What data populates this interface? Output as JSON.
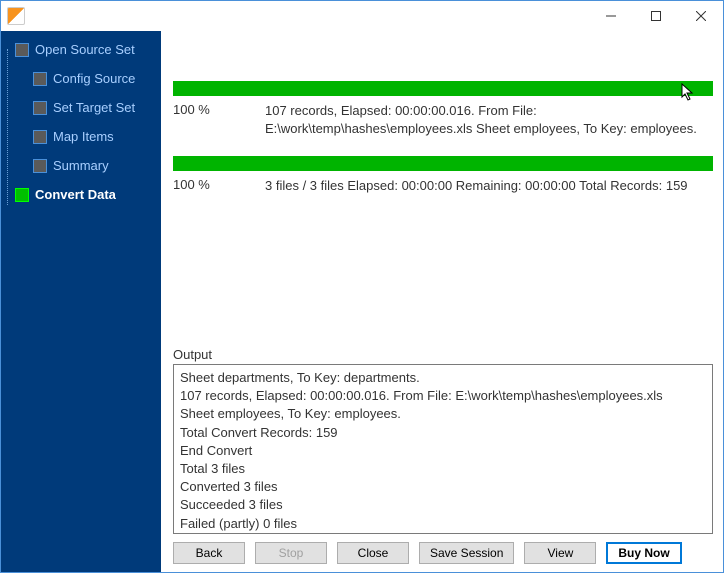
{
  "colors": {
    "sidebar_bg": "#003a7a",
    "accent": "#0078d7",
    "progress": "#00b400"
  },
  "titlebar": {
    "title": ""
  },
  "sidebar": {
    "root_label": "Open Source Set",
    "items": [
      {
        "label": "Config Source",
        "active": false
      },
      {
        "label": "Set Target Set",
        "active": false
      },
      {
        "label": "Map Items",
        "active": false
      },
      {
        "label": "Summary",
        "active": false
      },
      {
        "label": "Convert Data",
        "active": true
      }
    ]
  },
  "progress": {
    "task": {
      "percent_label": "100 %",
      "text": "107 records,    Elapsed: 00:00:00.016.    From File: E:\\work\\temp\\hashes\\employees.xls Sheet employees,    To Key: employees."
    },
    "overall": {
      "percent_label": "100 %",
      "text": "3 files / 3 files    Elapsed: 00:00:00    Remaining: 00:00:00    Total Records: 159"
    }
  },
  "output": {
    "label": "Output",
    "lines": [
      "Sheet departments,    To Key: departments.",
      "107 records,    Elapsed: 00:00:00.016.    From File: E:\\work\\temp\\hashes\\employees.xls",
      "Sheet employees,    To Key: employees.",
      "Total Convert Records: 159",
      "End Convert",
      "Total 3 files",
      "Converted 3 files",
      "Succeeded 3 files",
      "Failed (partly) 0 files"
    ]
  },
  "buttons": {
    "back": "Back",
    "stop": "Stop",
    "close": "Close",
    "save_session": "Save Session",
    "view": "View",
    "buy_now": "Buy Now"
  }
}
